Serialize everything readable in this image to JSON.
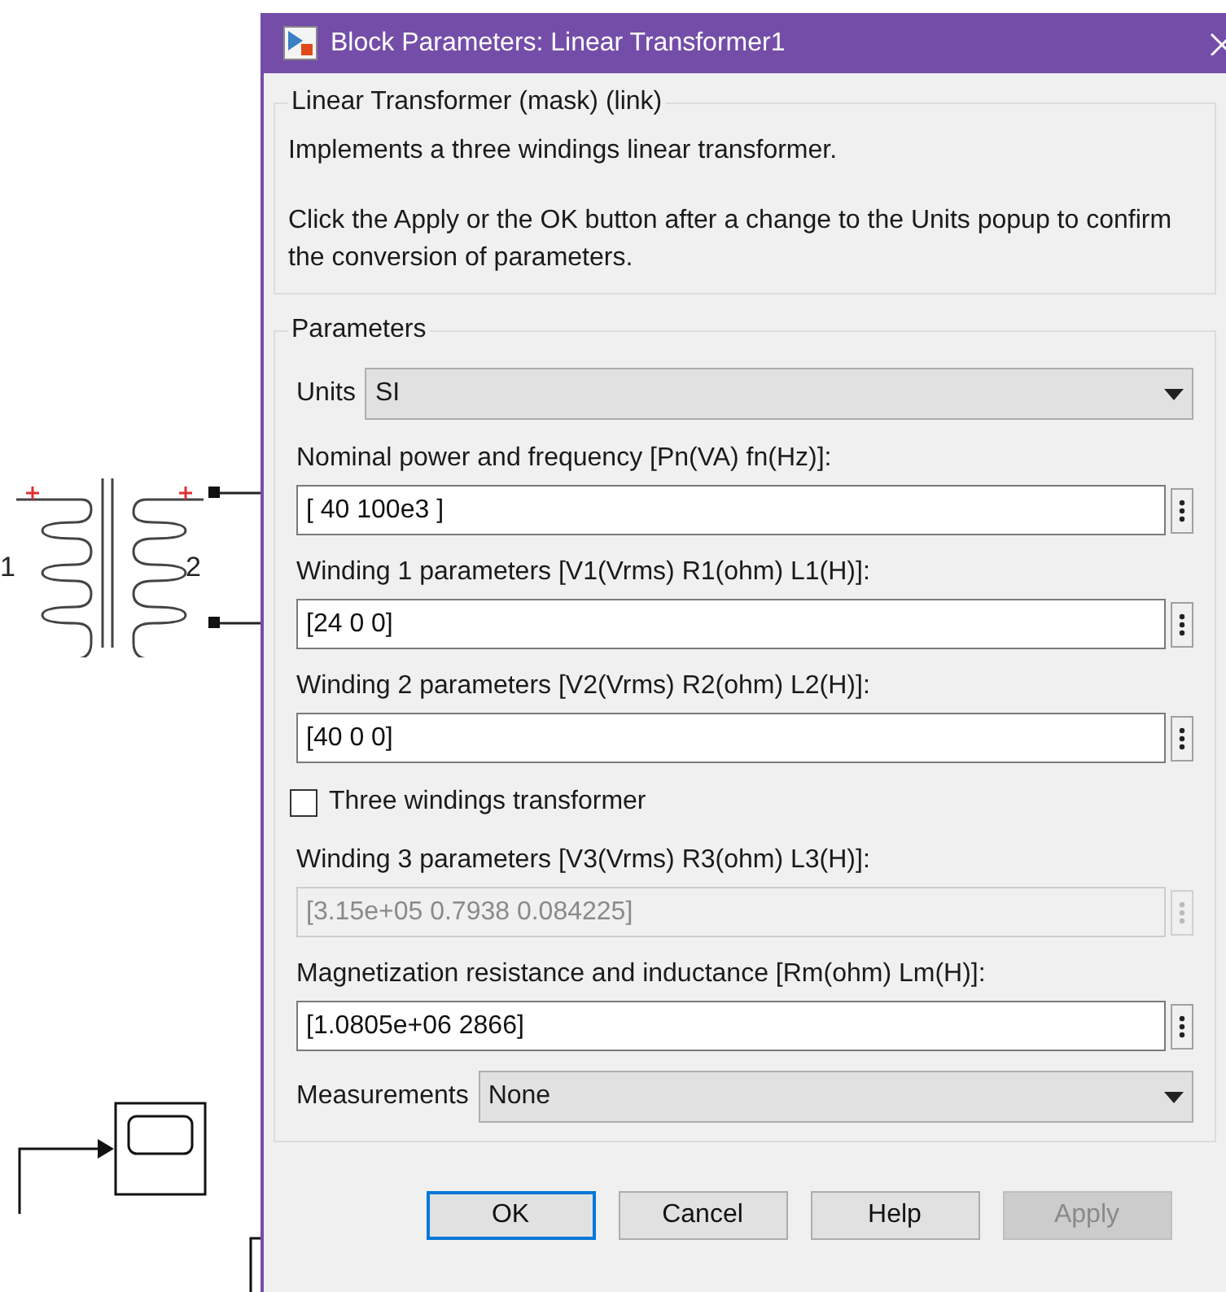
{
  "canvas": {
    "transformer_labels": [
      "1",
      "2"
    ]
  },
  "window": {
    "title": "Block Parameters: Linear Transformer1"
  },
  "mask": {
    "title": "Linear Transformer (mask) (link)",
    "description": [
      "Implements a three windings linear transformer.",
      "Click the Apply or the OK button after a change to the Units popup to confirm the conversion of parameters."
    ]
  },
  "parameters": {
    "title": "Parameters",
    "items": [
      {
        "kind": "select",
        "label": "Units",
        "value": "SI"
      },
      {
        "kind": "text",
        "label": "Nominal power and frequency [Pn(VA) fn(Hz)]:",
        "value": "[ 40 100e3 ]",
        "disabled": false
      },
      {
        "kind": "text",
        "label": "Winding 1 parameters [V1(Vrms) R1(ohm) L1(H)]:",
        "value": "[24 0 0]",
        "disabled": false
      },
      {
        "kind": "text",
        "label": "Winding 2 parameters [V2(Vrms) R2(ohm) L2(H)]:",
        "value": "[40 0 0]",
        "disabled": false
      },
      {
        "kind": "checkbox",
        "label": "Three windings transformer",
        "checked": false
      },
      {
        "kind": "text",
        "label": "Winding 3 parameters [V3(Vrms) R3(ohm) L3(H)]:",
        "value": "[3.15e+05 0.7938 0.084225]",
        "disabled": true
      },
      {
        "kind": "text",
        "label": "Magnetization resistance and inductance [Rm(ohm) Lm(H)]:",
        "value": "[1.0805e+06 2866]",
        "disabled": false
      },
      {
        "kind": "select",
        "label": "Measurements",
        "value": "None"
      }
    ]
  },
  "buttons": [
    {
      "label": "OK",
      "default": true,
      "disabled": false
    },
    {
      "label": "Cancel",
      "default": false,
      "disabled": false
    },
    {
      "label": "Help",
      "default": false,
      "disabled": false
    },
    {
      "label": "Apply",
      "default": false,
      "disabled": true
    }
  ]
}
